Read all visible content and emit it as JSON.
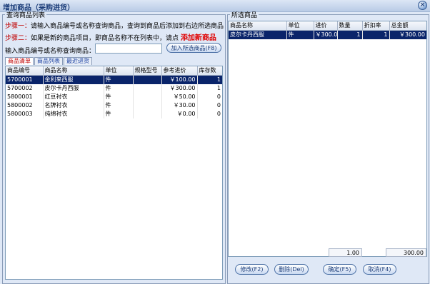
{
  "window": {
    "title": "增加商品（采购进货）"
  },
  "left": {
    "legend": "查询商品列表",
    "step1_label": "步骤一：",
    "step1_text": "请输入商品编号或名称查询商品，查询到商品后添加到右边所选商品",
    "step2_label": "步骤二：",
    "step2_text": "如果是新的商品项目，即商品名称不在列表中，请点",
    "add_new_link": "添加新商品",
    "search_label": "输入商品编号或名称查询商品：",
    "search_value": "",
    "add_selected_button": "加入所选商品(F8)",
    "tabs": [
      "商品清单",
      "商品列表",
      "最近进货"
    ],
    "columns": [
      "商品编号",
      "商品名称",
      "单位",
      "规格型号",
      "参考进价",
      "库存数"
    ],
    "rows": [
      {
        "code": "5700001",
        "name": "金利来西服",
        "unit": "件",
        "spec": "",
        "price": "￥100.00",
        "stock": "1"
      },
      {
        "code": "5700002",
        "name": "皮尔卡丹西服",
        "unit": "件",
        "spec": "",
        "price": "￥300.00",
        "stock": "1"
      },
      {
        "code": "5800001",
        "name": "红豆衬衣",
        "unit": "件",
        "spec": "",
        "price": "￥50.00",
        "stock": "0"
      },
      {
        "code": "5800002",
        "name": "名牌衬衣",
        "unit": "件",
        "spec": "",
        "price": "￥30.00",
        "stock": "0"
      },
      {
        "code": "5800003",
        "name": "纯绵衬衣",
        "unit": "件",
        "spec": "",
        "price": "￥0.00",
        "stock": "0"
      }
    ]
  },
  "right": {
    "legend": "所选商品",
    "columns": [
      "商品名称",
      "单位",
      "进价",
      "数量",
      "折扣率",
      "总金额"
    ],
    "rows": [
      {
        "name": "皮尔卡丹西服",
        "unit": "件",
        "price": "￥300.0",
        "qty": "1",
        "discount": "1",
        "total": "￥300.00"
      }
    ],
    "footer_qty": "1.00",
    "footer_total": "300.00"
  },
  "buttons": {
    "edit": "修改(F2)",
    "delete": "删除(Del)",
    "ok": "确定(F5)",
    "cancel": "取消(F4)"
  }
}
